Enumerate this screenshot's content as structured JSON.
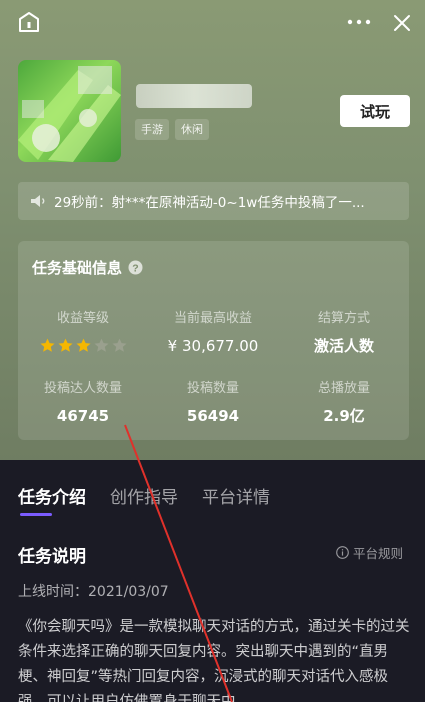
{
  "header": {
    "home_icon": "home-icon",
    "more_icon": "more-dots-icon",
    "close_icon": "close-icon"
  },
  "game": {
    "tags": [
      "手游",
      "休闲"
    ],
    "try_label": "试玩"
  },
  "ticker": {
    "icon": "speaker-icon",
    "text": "29秒前：射***在原神活动-0~1w任务中投稿了一..."
  },
  "info": {
    "title": "任务基础信息",
    "help_icon": "help-icon",
    "stats": [
      {
        "label": "收益等级",
        "stars_filled": 3,
        "stars_total": 5
      },
      {
        "label": "当前最高收益",
        "value": "¥ 30,677.00"
      },
      {
        "label": "结算方式",
        "value": "激活人数"
      },
      {
        "label": "投稿达人数量",
        "value": "46745"
      },
      {
        "label": "投稿数量",
        "value": "56494"
      },
      {
        "label": "总播放量",
        "value": "2.9亿"
      }
    ]
  },
  "tabs": [
    {
      "label": "任务介绍",
      "active": true
    },
    {
      "label": "创作指导",
      "active": false
    },
    {
      "label": "平台详情",
      "active": false
    }
  ],
  "section": {
    "title": "任务说明",
    "rules_label": "平台规则",
    "online_time": "上线时间：2021/03/07",
    "description": "《你会聊天吗》是一款模拟聊天对话的方式，通过关卡的过关条件来选择正确的聊天回复内容。突出聊天中遇到的“直男梗、神回复”等热门回复内容，沉浸式的聊天对话代入感极强，可以让用户仿佛置身于聊天中"
  },
  "colors": {
    "accent": "#7b5cff",
    "star_filled": "#f5b700",
    "star_empty": "#9aa08e",
    "annotation_arrow": "#e0312b"
  }
}
